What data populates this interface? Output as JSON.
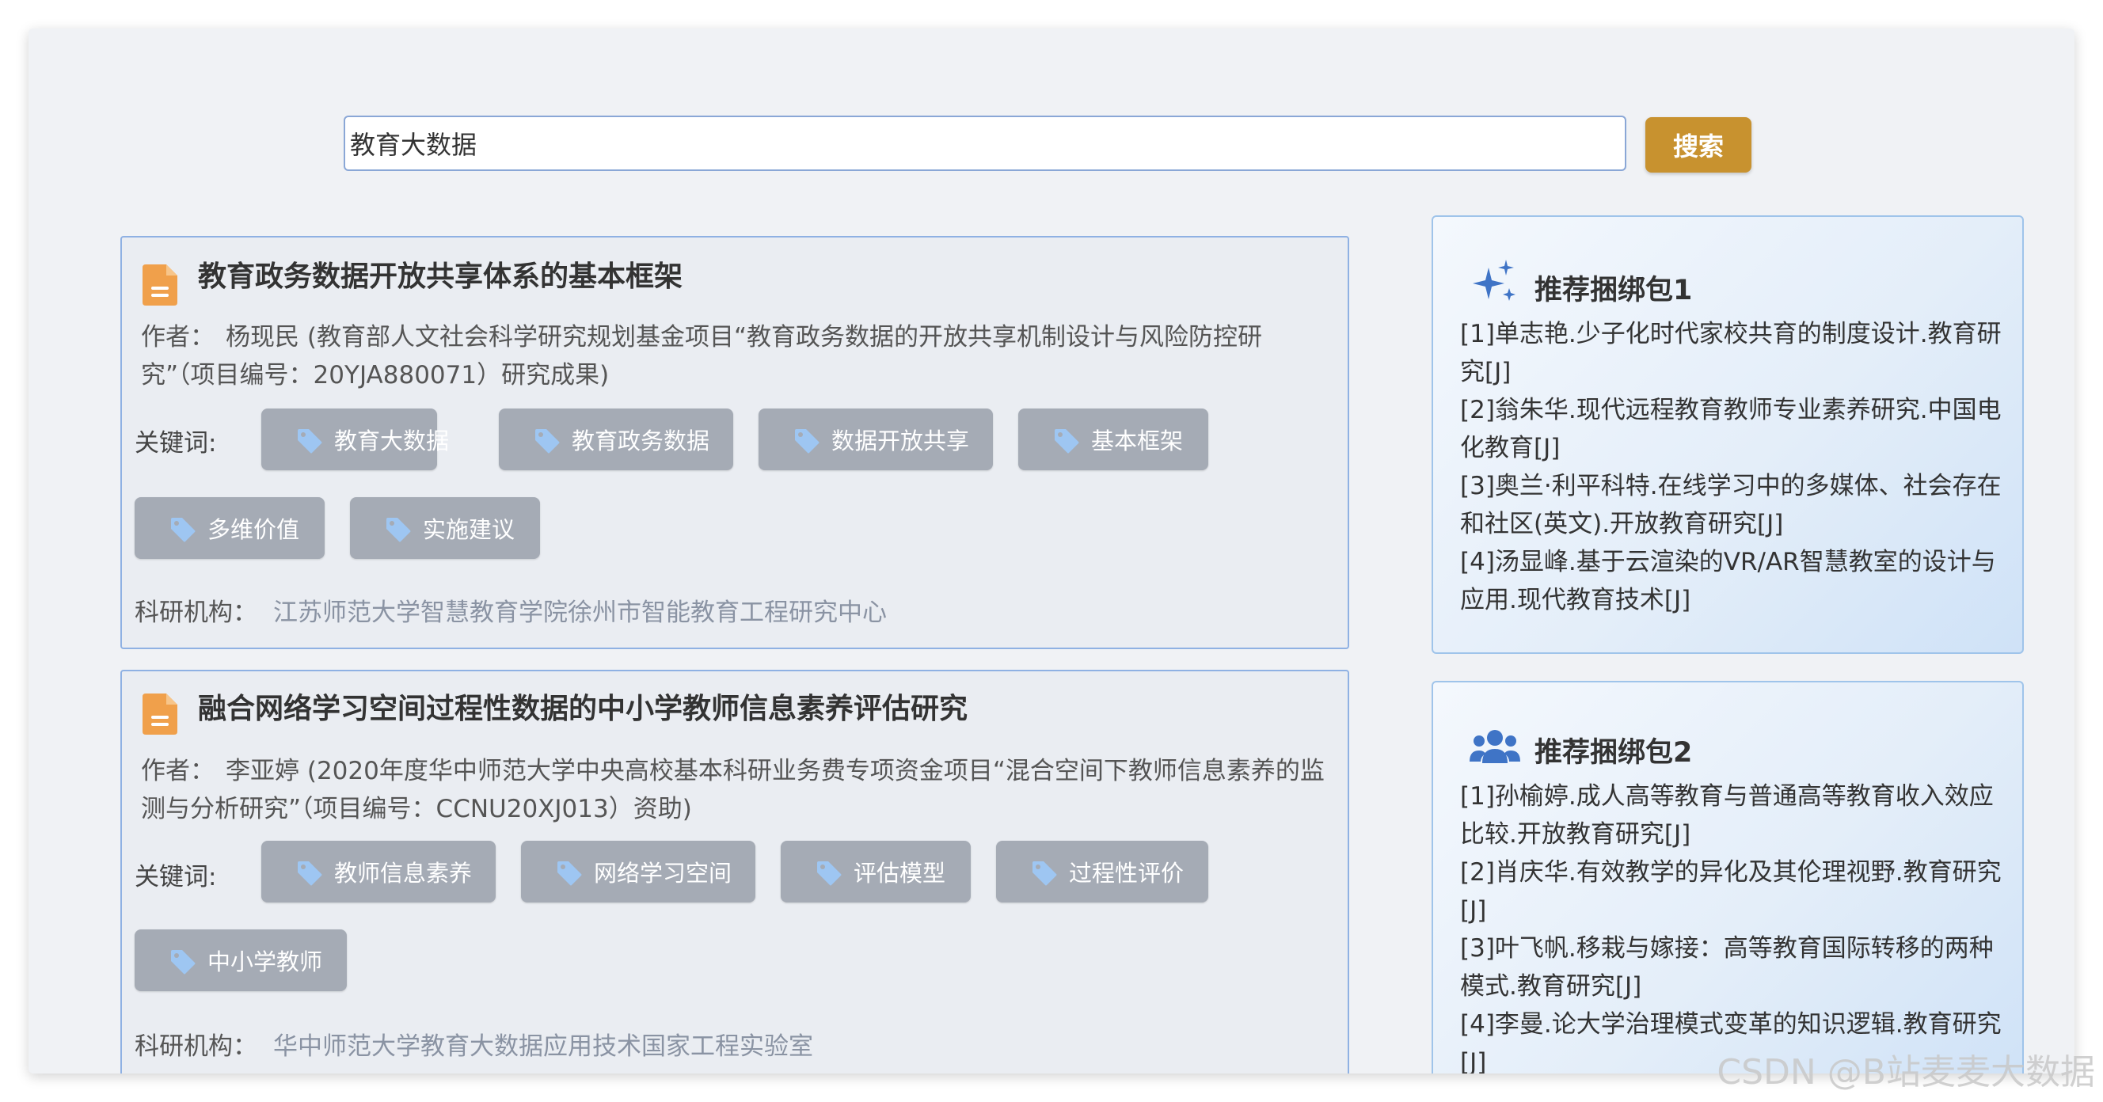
{
  "search": {
    "value": "教育大数据",
    "button_label": "搜索"
  },
  "results": [
    {
      "title": "教育政务数据开放共享体系的基本框架",
      "author_label": "作者：",
      "author_text": "杨现民 (教育部人文社会科学研究规划基金项目“教育政务数据的开放共享机制设计与风险防控研究”（项目编号：20YJA880071）研究成果)",
      "keywords_label": "关键词:",
      "keywords": [
        "教育大数据",
        "教育政务数据",
        "数据开放共享",
        "基本框架",
        "多维价值",
        "实施建议"
      ],
      "org_label": "科研机构：",
      "org_value": "江苏师范大学智慧教育学院徐州市智能教育工程研究中心"
    },
    {
      "title": "融合网络学习空间过程性数据的中小学教师信息素养评估研究",
      "author_label": "作者：",
      "author_text": "李亚婷 (2020年度华中师范大学中央高校基本科研业务费专项资金项目“混合空间下教师信息素养的监测与分析研究”（项目编号：CCNU20XJ013）资助)",
      "keywords_label": "关键词:",
      "keywords": [
        "教师信息素养",
        "网络学习空间",
        "评估模型",
        "过程性评价",
        "中小学教师"
      ],
      "org_label": "科研机构：",
      "org_value": "华中师范大学教育大数据应用技术国家工程实验室"
    }
  ],
  "recommendations": [
    {
      "title": "推荐捆绑包1",
      "icon": "sparkles-icon",
      "items": [
        "[1]单志艳.少子化时代家校共育的制度设计.教育研究[J]",
        "[2]翁朱华.现代远程教育教师专业素养研究.中国电化教育[J]",
        "[3]奥兰·利平科特.在线学习中的多媒体、社会存在和社区(英文).开放教育研究[J]",
        "[4]汤显峰.基于云渲染的VR/AR智慧教室的设计与应用.现代教育技术[J]"
      ]
    },
    {
      "title": "推荐捆绑包2",
      "icon": "users-icon",
      "items": [
        "[1]孙榆婷.成人高等教育与普通高等教育收入效应比较.开放教育研究[J]",
        "[2]肖庆华.有效教学的异化及其伦理视野.教育研究[J]",
        "[3]叶飞帆.移栽与嫁接：高等教育国际转移的两种模式.教育研究[J]",
        "[4]李曼.论大学治理模式变革的知识逻辑.教育研究[J]"
      ]
    }
  ],
  "watermark": "CSDN @B站麦麦大数据",
  "colors": {
    "accent": "#c8922f",
    "doc_icon": "#f0a04b",
    "tag_bg": "#a5abb5",
    "card_border": "#8fb1e3",
    "rec_icon": "#3f74c6"
  }
}
